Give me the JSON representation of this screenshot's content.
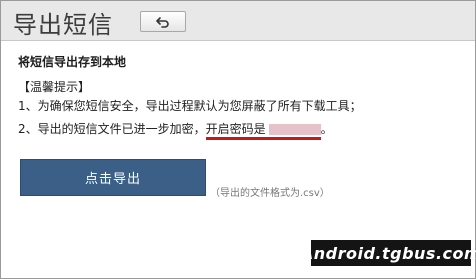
{
  "header": {
    "title": "导出短信",
    "back_icon": "undo-arrow-icon"
  },
  "content": {
    "section_title": "将短信导出存到本地",
    "tips_heading": "【温馨提示】",
    "tip1": "1、为确保您短信安全，导出过程默认为您屏蔽了所有下载工具；",
    "tip2_prefix": "2、导出的短信文件已进一步加密，",
    "tip2_highlight": "开启密码是",
    "tip2_suffix": "。"
  },
  "actions": {
    "export_label": "点击导出",
    "format_note": "（导出的文件格式为.csv）"
  },
  "watermark": {
    "text": "Android.tgbus.com"
  },
  "colors": {
    "button_bg": "#3b5f86",
    "highlight_underline": "#c21a1a",
    "header_bg": "#e8e8e8"
  }
}
